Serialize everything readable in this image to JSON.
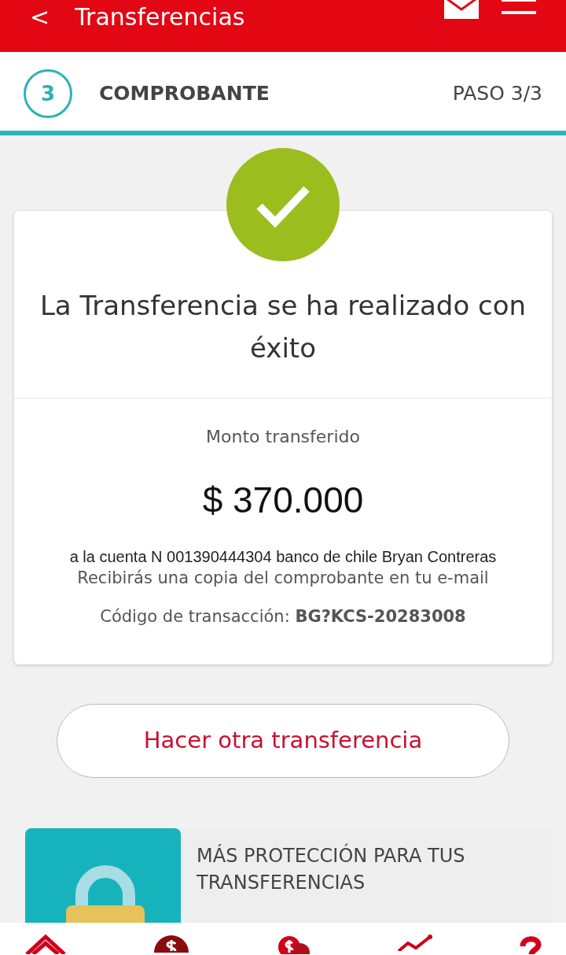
{
  "header": {
    "back": "<",
    "title": "Transferencias"
  },
  "step": {
    "number": "3",
    "label": "COMPROBANTE",
    "progress": "PASO 3/3",
    "level": 1
  },
  "receipt": {
    "title": "La Transferencia se ha realizado con éxito",
    "amount_label": "Monto transferido",
    "amount": "$ 370.000",
    "account_line": "a la cuenta N 001390444304 banco de chile Bryan Contreras",
    "email_note": "Recibirás una copia del comprobante en tu e-mail",
    "code": "Código de transacción: **BG?KCS-20283008**"
  },
  "action_button": "Hacer otra transferencia",
  "promo": {
    "title": "MÁS PROTECCIÓN PARA TUS TRANSFERENCIAS"
  },
  "bottom_nav": [
    {
      "kind": "home"
    },
    {
      "kind": "dollar"
    },
    {
      "kind": "exchange"
    },
    {
      "kind": "chart"
    },
    {
      "kind": "help"
    }
  ]
}
